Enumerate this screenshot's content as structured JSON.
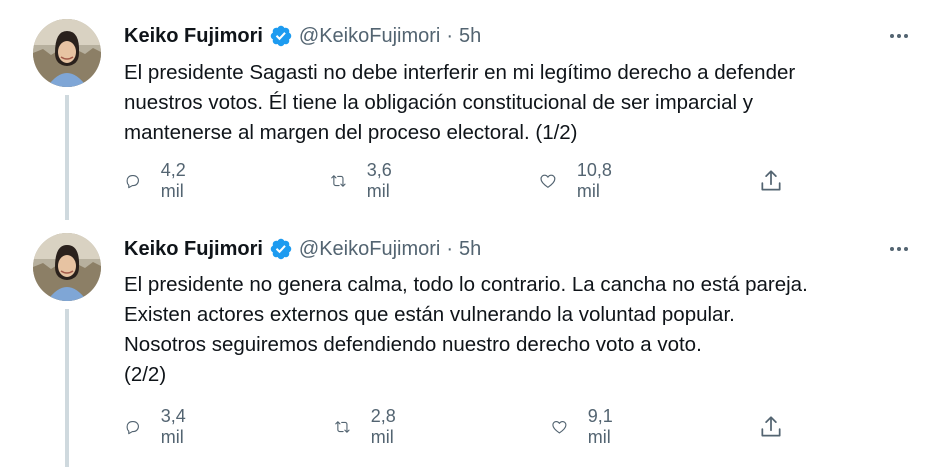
{
  "tweets": [
    {
      "author_name": "Keiko Fujimori",
      "handle": "@KeikoFujimori",
      "separator": "·",
      "time": "5h",
      "text_lines": [
        "El presidente Sagasti no debe interferir en mi legítimo derecho a defender",
        "nuestros votos. Él tiene la obligación constitucional de ser imparcial y",
        "mantenerse al margen del proceso electoral. (1/2)"
      ],
      "replies": "4,2 mil",
      "retweets": "3,6 mil",
      "likes": "10,8 mil"
    },
    {
      "author_name": "Keiko Fujimori",
      "handle": "@KeikoFujimori",
      "separator": "·",
      "time": "5h",
      "text_lines": [
        "El presidente no genera calma, todo lo contrario. La cancha no está pareja.",
        "Existen actores externos que están vulnerando la voluntad popular.",
        "Nosotros seguiremos defendiendo nuestro derecho voto a voto.",
        "(2/2)"
      ],
      "replies": "3,4 mil",
      "retweets": "2,8 mil",
      "likes": "9,1 mil"
    }
  ],
  "icons": {
    "verified": "verified-badge-icon",
    "more": "more-options-icon",
    "reply": "reply-icon",
    "retweet": "retweet-icon",
    "like": "heart-icon",
    "share": "share-icon"
  },
  "colors": {
    "text": "#0f1419",
    "secondary": "#536471",
    "verified": "#1d9bf0",
    "thread_line": "#cfd9de"
  }
}
